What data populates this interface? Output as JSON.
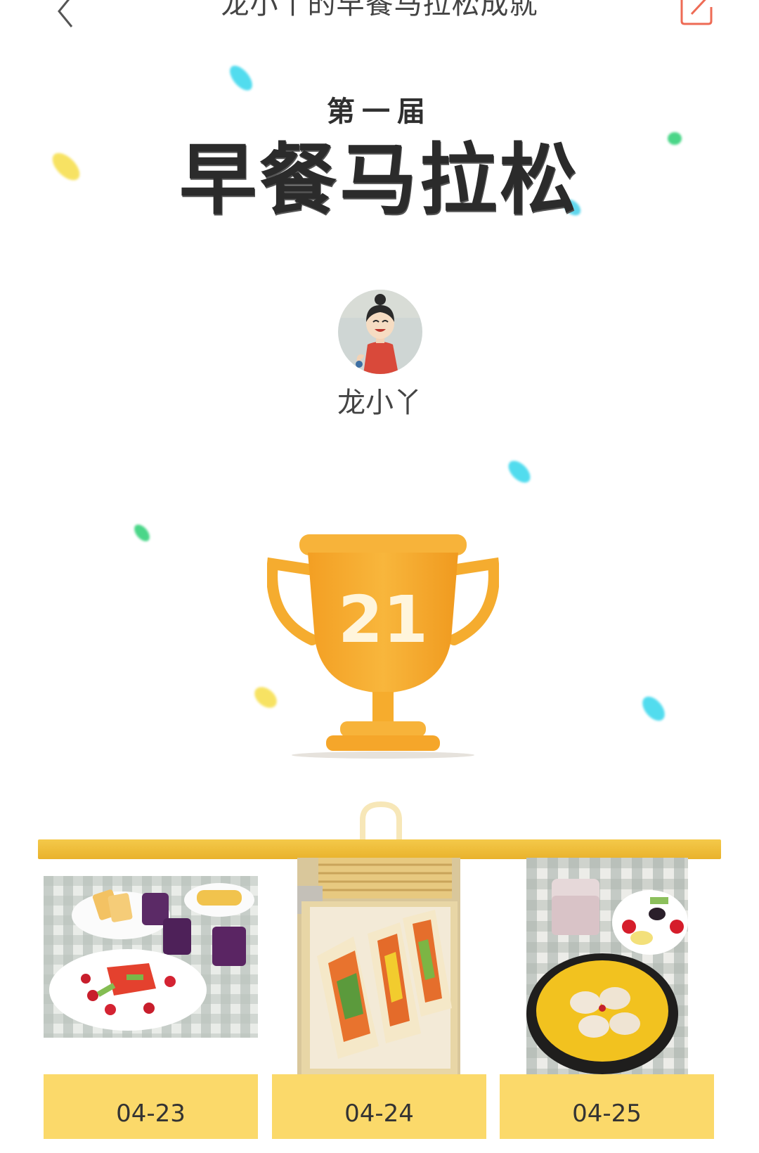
{
  "header": {
    "title": "龙小丫的早餐马拉松成就"
  },
  "event": {
    "edition": "第一届",
    "title": "早餐马拉松"
  },
  "user": {
    "name": "龙小丫"
  },
  "trophy": {
    "count": "21"
  },
  "colors": {
    "shelf": "#f0bf3a",
    "card_label": "#fbd96a",
    "trophy": "#f6ad2f",
    "edit_icon": "#ee6b55"
  },
  "icons": {
    "back": "chevron-left-icon",
    "edit": "edit-icon",
    "trophy": "trophy-icon"
  },
  "entries": [
    {
      "date": "04-23"
    },
    {
      "date": "04-24"
    },
    {
      "date": "04-25"
    }
  ]
}
